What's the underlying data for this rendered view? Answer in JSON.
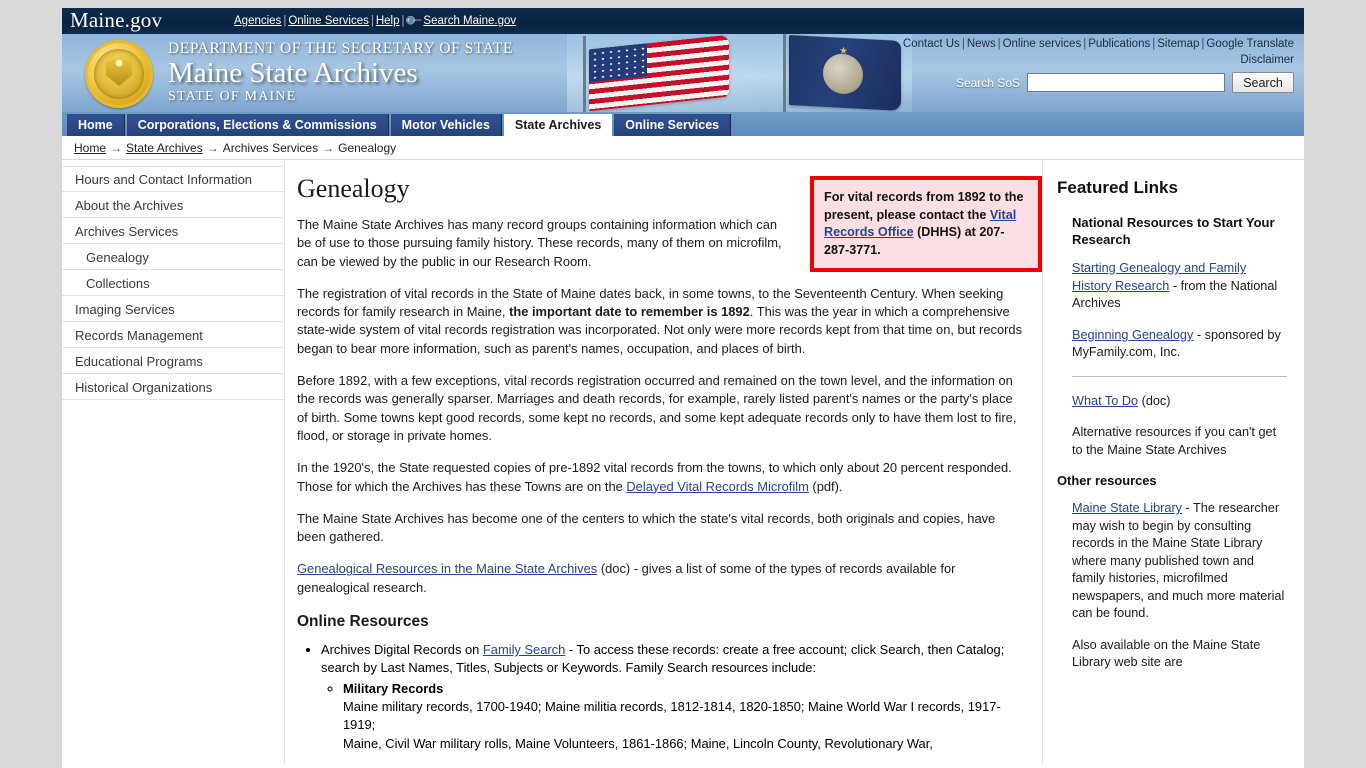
{
  "topbar": {
    "logo": "Maine.gov",
    "links": [
      {
        "label": "Agencies"
      },
      {
        "label": "Online Services"
      },
      {
        "label": "Help"
      },
      {
        "label": "Search Maine.gov",
        "icon": "search-icon"
      }
    ]
  },
  "banner": {
    "dept_line1": "DEPARTMENT OF THE SECRETARY OF STATE",
    "dept_line2": "Maine State Archives",
    "dept_line3": "STATE OF MAINE",
    "seal_alt": "state-seal",
    "util_links": [
      "Contact Us",
      "News",
      "Online services",
      "Publications",
      "Sitemap",
      "Google Translate",
      "Disclaimer"
    ],
    "search_label": "Search SoS",
    "search_value": "",
    "search_placeholder": "",
    "search_button": "Search"
  },
  "nav": {
    "tabs": [
      {
        "label": "Home",
        "active": false
      },
      {
        "label": "Corporations, Elections & Commissions",
        "active": false
      },
      {
        "label": "Motor Vehicles",
        "active": false
      },
      {
        "label": "State Archives",
        "active": true
      },
      {
        "label": "Online Services",
        "active": false
      }
    ]
  },
  "breadcrumb": {
    "items": [
      {
        "label": "Home",
        "link": true
      },
      {
        "label": "State Archives",
        "link": true
      },
      {
        "label": "Archives Services",
        "link": false
      },
      {
        "label": "Genealogy",
        "link": false
      }
    ],
    "separator": "→"
  },
  "sidebar": {
    "items": [
      {
        "label": "Hours and Contact Information",
        "sub": false
      },
      {
        "label": "About the Archives",
        "sub": false
      },
      {
        "label": "Archives Services",
        "sub": false
      },
      {
        "label": "Genealogy",
        "sub": true
      },
      {
        "label": "Collections",
        "sub": true
      },
      {
        "label": "Imaging Services",
        "sub": false
      },
      {
        "label": "Records Management",
        "sub": false
      },
      {
        "label": "Educational Programs",
        "sub": false
      },
      {
        "label": "Historical Organizations",
        "sub": false
      }
    ]
  },
  "main": {
    "title": "Genealogy",
    "callout": {
      "text_1": "For vital records from 1892 to the present, please contact the ",
      "link": "Vital Records Office",
      "text_2": " (DHHS) at 207-287-3771."
    },
    "p1": "The Maine State Archives has many record groups containing information which can be of use to those pursuing family history. These records, many of them on microfilm, can be viewed by the public in our Research Room.",
    "p2_a": "The registration of vital records in the State of Maine dates back, in some towns, to the Seventeenth Century. When seeking records for family research in Maine, ",
    "p2_b": "the important date to remember is 1892",
    "p2_c": ". This was the year in which a comprehensive state-wide system of vital records registration was incorporated. Not only were more records kept from that time on, but records began to bear more information, such as parent's names, occupation, and places of birth.",
    "p3": "Before 1892, with a few exceptions, vital records registration occurred and remained on the town level, and the information on the records was generally sparser.  Marriages and death records, for example, rarely listed parent's names or the party's place of birth. Some towns kept good records, some kept no records, and some kept adequate records only to have them lost to fire, flood, or storage in private homes.",
    "p4_a": "In the 1920's, the State requested copies of pre-1892 vital records from the towns, to which only about 20 percent responded.  Those for which the Archives has these Towns are on the ",
    "p4_link": "Delayed Vital Records Microfilm",
    "p4_b": " (pdf).",
    "p5": "The Maine State Archives has become one of the centers to which the state's vital records, both originals and copies, have been gathered.",
    "p6_link": "Genealogical Resources in the Maine State Archives",
    "p6_b": " (doc) - gives a list of some of the types of records available for genealogical research.",
    "online_resources_heading": "Online Resources",
    "bullet1_a": "Archives Digital Records on ",
    "bullet1_link": "Family Search",
    "bullet1_b": " - To access these records: create a free account; click Search, then Catalog; search by Last Names, Titles, Subjects or Keywords. Family Search resources include:",
    "sub_bullet_title": "Military Records",
    "sub_bullet_text_1": "Maine military records, 1700-1940; Maine militia records, 1812-1814, 1820-1850; Maine World War I records, 1917-1919;",
    "sub_bullet_text_2": "Maine, Civil War military rolls, Maine Volunteers, 1861-1866; Maine, Lincoln County, Revolutionary War,"
  },
  "rightcol": {
    "featured_title": "Featured Links",
    "heading_1": "National Resources to Start Your Research",
    "item1_link": "Starting Genealogy and Family History Research",
    "item1_text": " - from the National Archives",
    "item2_link": "Beginning Genealogy",
    "item2_text": " - sponsored by MyFamily.com, Inc.",
    "item3_link": "What To Do",
    "item3_text": " (doc)",
    "item3_desc": "Alternative resources if you can't get to the Maine State Archives",
    "heading_2": "Other resources",
    "item4_link": "Maine State Library",
    "item4_text": " - The researcher may wish to begin by consulting records in the Maine State Library where many published town and family histories, microfilmed newspapers, and much more material can be found.",
    "item5_text": "Also available on the Maine State Library web site are"
  },
  "colors": {
    "topbar": "#0a2340",
    "nav_tab": "#2d4a87",
    "callout_border": "#ee0000",
    "callout_bg": "#fbdfe2",
    "link": "#26448f"
  }
}
